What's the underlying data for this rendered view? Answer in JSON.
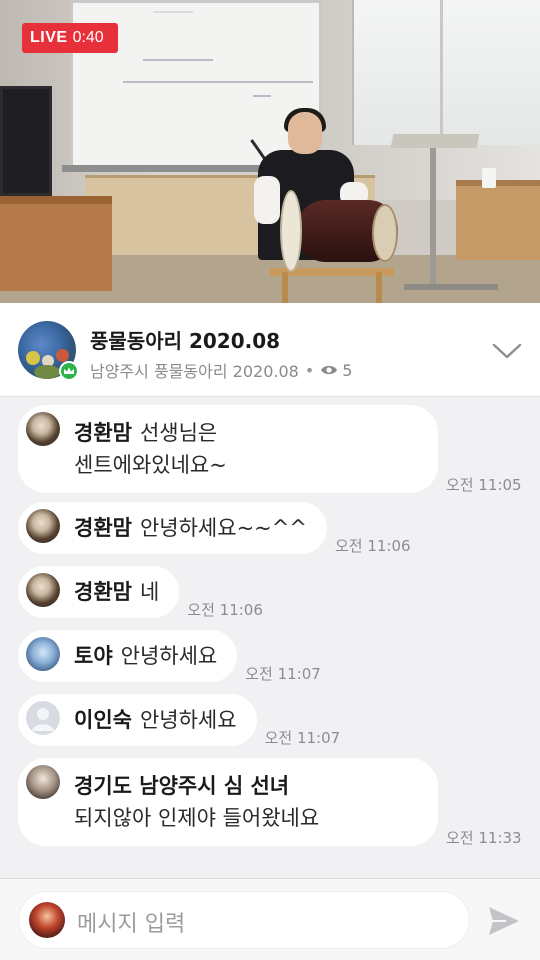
{
  "live": {
    "label": "LIVE",
    "time": "0:40"
  },
  "room": {
    "title": "풍물동아리 2020.08",
    "subtitle": "남양주시 풍물동아리 2020.08",
    "separator": "•",
    "viewers": "5"
  },
  "messages": [
    {
      "sender": "경환맘",
      "text_line1": "선생님은",
      "text_line2": "센트에와있네요~",
      "time": "오전 11:05"
    },
    {
      "sender": "경환맘",
      "text": "안녕하세요~~^^",
      "time": "오전 11:06"
    },
    {
      "sender": "경환맘",
      "text": "네",
      "time": "오전 11:06"
    },
    {
      "sender": "토야",
      "text": "안녕하세요",
      "time": "오전 11:07"
    },
    {
      "sender": "이인숙",
      "text": "안녕하세요",
      "time": "오전 11:07"
    },
    {
      "sender": "경기도 남양주시  심 선녀",
      "text": "되지않아 인제야 들어왔네요",
      "time": "오전 11:33"
    }
  ],
  "input": {
    "placeholder": "메시지 입력"
  },
  "icons": {
    "viewers": "eye-icon",
    "collapse": "chevron-down-icon",
    "send": "send-icon",
    "host": "crown-icon"
  },
  "colors": {
    "live_red": "#e8303a",
    "host_green": "#2db34a",
    "chat_bg": "#f1f1f3",
    "bubble_bg": "#ffffff",
    "time_text": "#8d8d91"
  }
}
